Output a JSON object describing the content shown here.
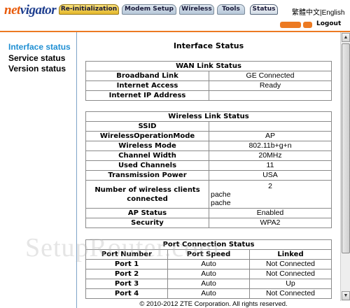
{
  "header": {
    "logo_part1": "net",
    "logo_part2": "vigator",
    "tabs": [
      {
        "label": "Re-initialization"
      },
      {
        "label": "Modem Setup"
      },
      {
        "label": "Wireless"
      },
      {
        "label": "Tools"
      },
      {
        "label": "Status"
      }
    ],
    "lang_zh": "繁體中文",
    "lang_sep": "|",
    "lang_en": "English",
    "logout_label": "Logout",
    "accent_color": "#ec7a22"
  },
  "sidebar": {
    "items": [
      {
        "label": "Interface status",
        "active": true
      },
      {
        "label": "Service status"
      },
      {
        "label": "Version status"
      }
    ]
  },
  "main": {
    "title": "Interface Status",
    "wan": {
      "header": "WAN Link Status",
      "rows": [
        {
          "label": "Broadband Link",
          "value": "GE Connected"
        },
        {
          "label": "Internet Access",
          "value": "Ready"
        },
        {
          "label": "Internet IP Address",
          "value": ""
        }
      ]
    },
    "wireless": {
      "header": "Wireless Link Status",
      "rows": [
        {
          "label": "SSID",
          "value": ""
        },
        {
          "label": "WirelessOperationMode",
          "value": "AP"
        },
        {
          "label": "Wireless Mode",
          "value": "802.11b+g+n"
        },
        {
          "label": "Channel Width",
          "value": "20MHz"
        },
        {
          "label": "Used Channels",
          "value": "11"
        },
        {
          "label": "Transmission Power",
          "value": "USA"
        }
      ],
      "clients_label": "Number of wireless clients connected",
      "clients_count": "2",
      "clients_lines": [
        "pache",
        "pache"
      ],
      "rows2": [
        {
          "label": "AP Status",
          "value": "Enabled"
        },
        {
          "label": "Security",
          "value": "WPA2"
        }
      ]
    },
    "ports": {
      "header": "Port Connection Status",
      "columns": [
        "Port Number",
        "Port Speed",
        "Linked"
      ],
      "rows": [
        [
          "Port 1",
          "Auto",
          "Not Connected"
        ],
        [
          "Port 2",
          "Auto",
          "Not Connected"
        ],
        [
          "Port 3",
          "Auto",
          "Up"
        ],
        [
          "Port 4",
          "Auto",
          "Not Connected"
        ]
      ]
    }
  },
  "footer": {
    "text": "© 2010-2012 ZTE Corporation. All rights reserved."
  },
  "watermark": "SetupRouter.com"
}
